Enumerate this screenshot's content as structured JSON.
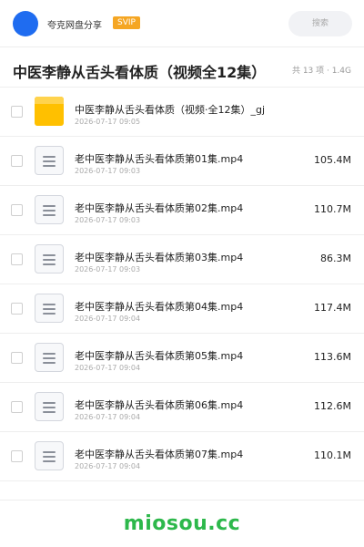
{
  "header": {
    "brand": "夸克网盘分享",
    "badge": "SVIP",
    "search_placeholder": "搜索"
  },
  "share": {
    "title": "中医李静从舌头看体质（视频全12集）",
    "meta": "共 13 项 · 1.4G"
  },
  "files": [
    {
      "type": "folder",
      "name": "中医李静从舌头看体质（视频·全12集）_gj",
      "date": "2026-07-17 09:05",
      "size": ""
    },
    {
      "type": "file",
      "name": "老中医李静从舌头看体质第01集.mp4",
      "date": "2026-07-17 09:03",
      "size": "105.4M"
    },
    {
      "type": "file",
      "name": "老中医李静从舌头看体质第02集.mp4",
      "date": "2026-07-17 09:03",
      "size": "110.7M"
    },
    {
      "type": "file",
      "name": "老中医李静从舌头看体质第03集.mp4",
      "date": "2026-07-17 09:03",
      "size": "86.3M"
    },
    {
      "type": "file",
      "name": "老中医李静从舌头看体质第04集.mp4",
      "date": "2026-07-17 09:04",
      "size": "117.4M"
    },
    {
      "type": "file",
      "name": "老中医李静从舌头看体质第05集.mp4",
      "date": "2026-07-17 09:04",
      "size": "113.6M"
    },
    {
      "type": "file",
      "name": "老中医李静从舌头看体质第06集.mp4",
      "date": "2026-07-17 09:04",
      "size": "112.6M"
    },
    {
      "type": "file",
      "name": "老中医李静从舌头看体质第07集.mp4",
      "date": "2026-07-17 09:04",
      "size": "110.1M"
    }
  ],
  "watermark": "miosou.cc",
  "colors": {
    "accent_blue": "#1f6cf0",
    "svip_orange": "#f5a623",
    "folder_yellow": "#ffc000",
    "watermark_green": "#2db84b"
  }
}
